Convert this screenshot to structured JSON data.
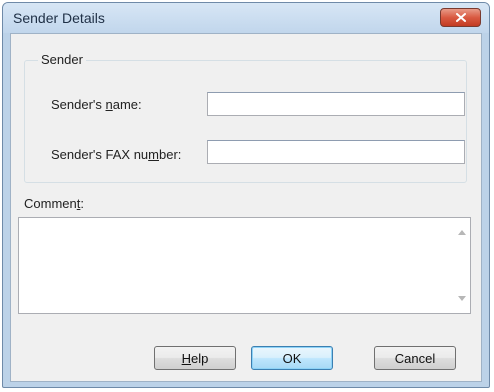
{
  "window": {
    "title": "Sender Details",
    "close_icon": "close-x-icon",
    "close_color": "#c8432b"
  },
  "sender_group": {
    "label": "Sender",
    "name_label": {
      "pre": "Sender's ",
      "key": "n",
      "post": "ame:"
    },
    "name_value": "",
    "fax_label": {
      "pre": "Sender's FAX nu",
      "key": "m",
      "post": "ber:"
    },
    "fax_value": ""
  },
  "comment": {
    "label": {
      "pre": "Commen",
      "key": "t",
      "post": ":"
    },
    "value": "",
    "scroll_up_icon": "scroll-up-arrow-icon",
    "scroll_down_icon": "scroll-down-arrow-icon"
  },
  "buttons": {
    "help": {
      "key": "H",
      "post": "elp"
    },
    "ok": "OK",
    "cancel": "Cancel"
  }
}
